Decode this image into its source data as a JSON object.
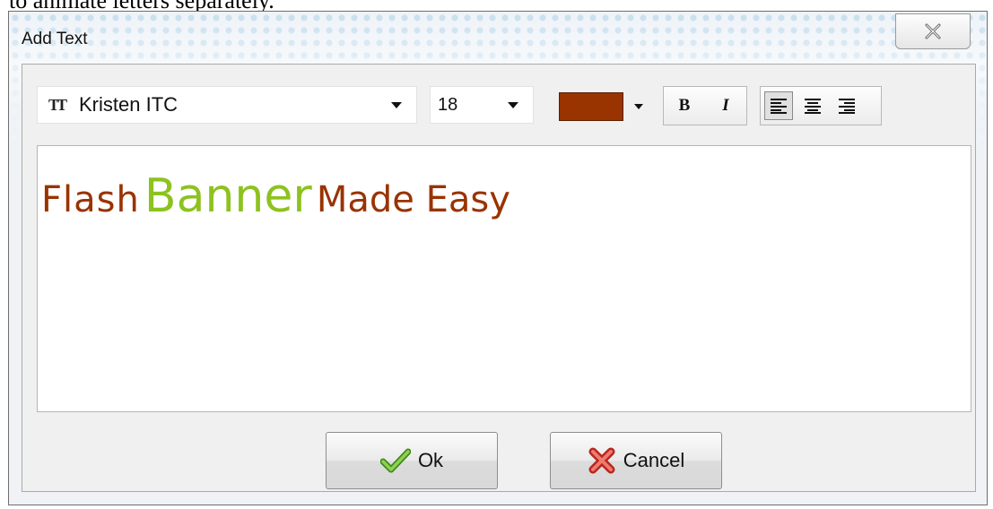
{
  "caption": "to animate letters separately.",
  "dialog": {
    "title": "Add Text",
    "close_icon": "close-icon"
  },
  "toolbar": {
    "font": {
      "icon": "font-icon",
      "value": "Kristen ITC"
    },
    "size": {
      "value": "18"
    },
    "color": {
      "value": "#993300"
    },
    "bold_label": "B",
    "italic_label": "I",
    "align": [
      "align-left-icon",
      "align-center-icon",
      "align-right-icon"
    ],
    "align_active": "left"
  },
  "editor": {
    "words": [
      {
        "text": "Flash",
        "color": "#993300"
      },
      {
        "text": "Banner",
        "color": "#8dc21f"
      },
      {
        "text": "Made Easy",
        "color": "#993300"
      }
    ]
  },
  "buttons": {
    "ok_label": "Ok",
    "ok_icon": "checkmark-icon",
    "cancel_label": "Cancel",
    "cancel_icon": "red-x-icon"
  }
}
